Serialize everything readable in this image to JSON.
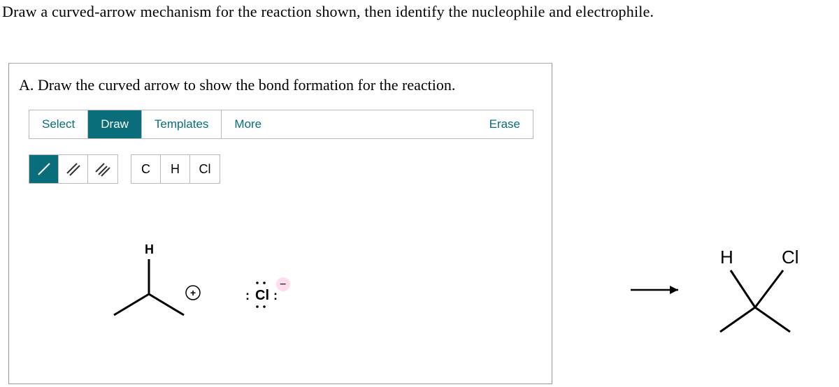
{
  "question": "Draw a curved-arrow mechanism for the reaction shown, then identify the nucleophile and electrophile.",
  "part": {
    "label": "A. Draw the curved arrow to show the bond formation for the reaction."
  },
  "toolbar": {
    "select": "Select",
    "draw": "Draw",
    "templates": "Templates",
    "more": "More",
    "erase": "Erase"
  },
  "elements": {
    "carbon": "C",
    "hydrogen": "H",
    "chlorine": "Cl"
  },
  "reactant": {
    "top_label": "H",
    "charge": "+",
    "anion": "Cl",
    "anion_charge": "−"
  },
  "product": {
    "left_label": "H",
    "right_label": "Cl"
  }
}
